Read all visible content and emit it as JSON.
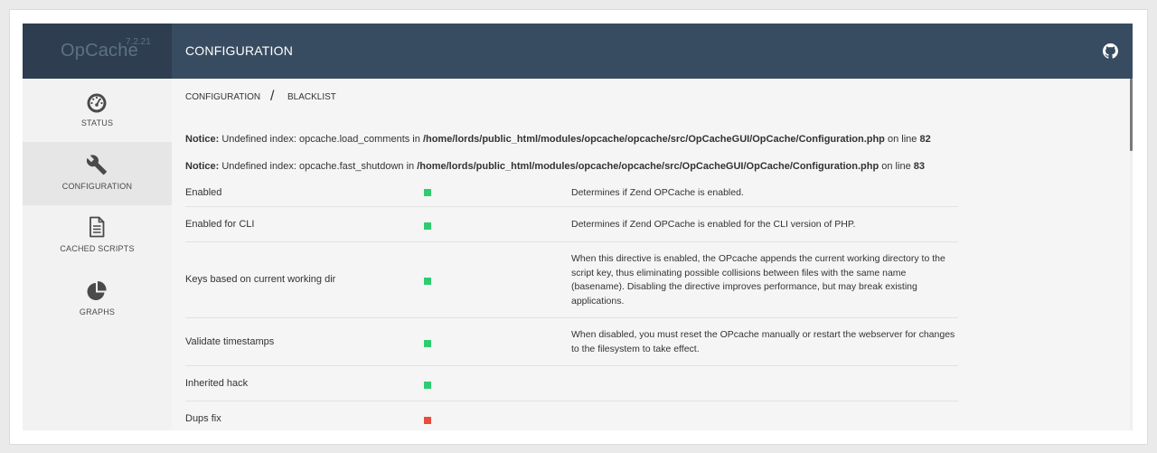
{
  "brand": {
    "name": "OpCache",
    "version": "7.2.21"
  },
  "header": {
    "title": "CONFIGURATION",
    "github_icon": "github-icon"
  },
  "sidebar": {
    "items": [
      {
        "label": "STATUS",
        "icon": "dashboard-icon",
        "active": false
      },
      {
        "label": "CONFIGURATION",
        "icon": "wrench-icon",
        "active": true
      },
      {
        "label": "CACHED SCRIPTS",
        "icon": "file-icon",
        "active": false
      },
      {
        "label": "GRAPHS",
        "icon": "pie-chart-icon",
        "active": false
      }
    ]
  },
  "tabs": {
    "configuration": "CONFIGURATION",
    "separator": "/",
    "blacklist": "BLACKLIST"
  },
  "notices": [
    {
      "label": "Notice:",
      "message": "Undefined index: opcache.load_comments in",
      "file": "/home/lords/public_html/modules/opcache/opcache/src/OpCacheGUI/OpCache/Configuration.php",
      "on_line": "on line",
      "line": "82"
    },
    {
      "label": "Notice:",
      "message": "Undefined index: opcache.fast_shutdown in",
      "file": "/home/lords/public_html/modules/opcache/opcache/src/OpCacheGUI/OpCache/Configuration.php",
      "on_line": "on line",
      "line": "83"
    }
  ],
  "config_rows": [
    {
      "name": "Enabled",
      "enabled": true,
      "description": "Determines if Zend OPCache is enabled."
    },
    {
      "name": "Enabled for CLI",
      "enabled": true,
      "description": "Determines if Zend OPCache is enabled for the CLI version of PHP."
    },
    {
      "name": "Keys based on current working dir",
      "enabled": true,
      "description": "When this directive is enabled, the OPcache appends the current working directory to the script key, thus eliminating possible collisions between files with the same name (basename). Disabling the directive improves performance, but may break existing applications."
    },
    {
      "name": "Validate timestamps",
      "enabled": true,
      "description": "When disabled, you must reset the OPcache manually or restart the webserver for changes to the filesystem to take effect."
    },
    {
      "name": "Inherited hack",
      "enabled": true,
      "description": ""
    },
    {
      "name": "Dups fix",
      "enabled": false,
      "description": ""
    }
  ],
  "colors": {
    "enabled": "#2ecc71",
    "disabled": "#e74c3c",
    "header_bg": "#384c61",
    "brand_bg": "#2e3e50"
  }
}
